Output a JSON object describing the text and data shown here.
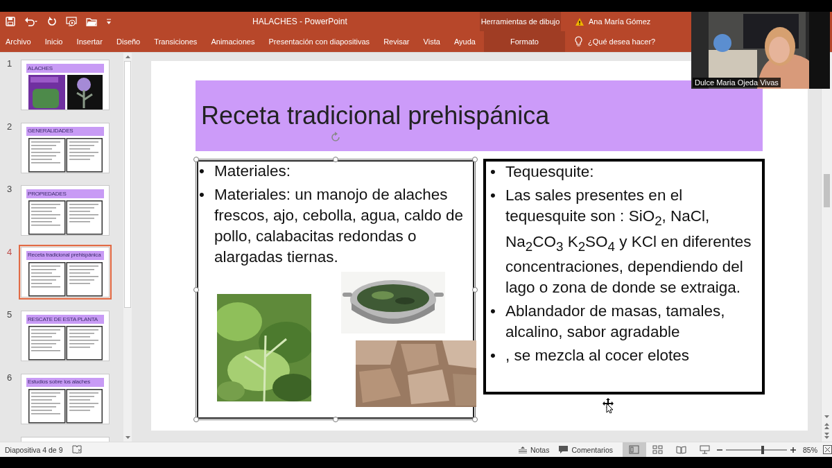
{
  "window": {
    "title": "HALACHES  -  PowerPoint",
    "user": "Ana María Gómez"
  },
  "ribbon": {
    "context_group": "Herramientas de dibujo",
    "tell_me": "¿Qué desea hacer?",
    "tabs": [
      {
        "label": "Archivo",
        "selected": false,
        "contextual": false
      },
      {
        "label": "Inicio",
        "selected": false,
        "contextual": false
      },
      {
        "label": "Insertar",
        "selected": false,
        "contextual": false
      },
      {
        "label": "Diseño",
        "selected": false,
        "contextual": false
      },
      {
        "label": "Transiciones",
        "selected": false,
        "contextual": false
      },
      {
        "label": "Animaciones",
        "selected": false,
        "contextual": false
      },
      {
        "label": "Presentación con diapositivas",
        "selected": false,
        "contextual": false
      },
      {
        "label": "Revisar",
        "selected": false,
        "contextual": false
      },
      {
        "label": "Vista",
        "selected": false,
        "contextual": false
      },
      {
        "label": "Ayuda",
        "selected": false,
        "contextual": false
      },
      {
        "label": "Formato",
        "selected": false,
        "contextual": true
      }
    ]
  },
  "video": {
    "name": "Dulce Maria Ojeda Vivas"
  },
  "thumbnails": [
    {
      "number": "1",
      "title": "ALACHES",
      "kind": "images",
      "selected": false
    },
    {
      "number": "2",
      "title": "GENERALIDADES",
      "kind": "columns",
      "selected": false
    },
    {
      "number": "3",
      "title": "PROPIEDADES",
      "kind": "columns",
      "selected": false
    },
    {
      "number": "4",
      "title": "Receta tradicional prehispánica",
      "kind": "columns",
      "selected": true
    },
    {
      "number": "5",
      "title": "RESCATE DE ESTA PLANTA",
      "kind": "columns",
      "selected": false
    },
    {
      "number": "6",
      "title": "Estudios sobre los alaches",
      "kind": "columns",
      "selected": false
    },
    {
      "kind": "blank",
      "selected": false
    }
  ],
  "slide": {
    "title": "Receta tradicional prehispánica",
    "left_box": {
      "selected": true,
      "bullets": [
        {
          "bullet": "•",
          "text": "Materiales:"
        },
        {
          "bullet": "•",
          "text": "Materiales: un manojo de alaches frescos, ajo, cebolla, agua, caldo de pollo, calabacitas redondas o alargadas tiernas."
        }
      ]
    },
    "right_box": {
      "selected": false,
      "bullets": [
        {
          "bullet": "•",
          "text": "Tequesquite:"
        },
        {
          "bullet": "•",
          "text": "Las sales presentes en el tequesquite son : SiO$_{2}$, NaCl, Na$_{2}$CO$_{3}$  K$_{2}$SO$_{4}$ y KCl en diferentes concentraciones, dependiendo del lago o zona de donde se extraiga."
        },
        {
          "bullet": "•",
          "text": "Ablandador de masas, tamales, alcalino, sabor agradable"
        },
        {
          "bullet": "•",
          "text": ", se mezcla al cocer elotes"
        }
      ]
    }
  },
  "status_bar": {
    "slide_info": "Diapositiva 4 de 9",
    "notes": "Notas",
    "comments": "Comentarios",
    "views": [
      {
        "kind": "normal",
        "selected": true
      },
      {
        "kind": "sorter",
        "selected": false
      },
      {
        "kind": "reading",
        "selected": false
      },
      {
        "kind": "slideshow",
        "selected": false
      }
    ],
    "zoom": {
      "level": 0.6,
      "reading": "85%"
    }
  }
}
